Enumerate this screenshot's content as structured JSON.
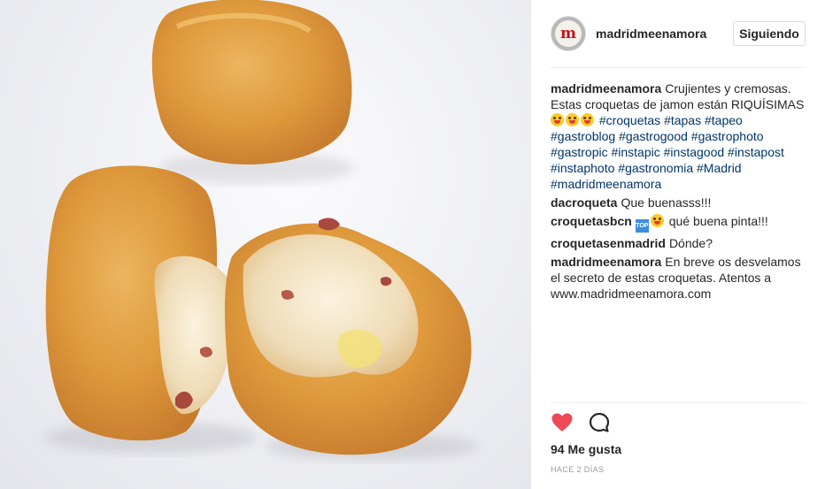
{
  "photo": {
    "alt_icon": "croquetas-photo"
  },
  "header": {
    "username": "madridmeenamora",
    "avatar_letter": "m",
    "follow_label": "Siguiendo"
  },
  "caption": {
    "username": "madridmeenamora",
    "text": "Crujientes y cremosas. Estas croquetas de jamon están RIQUÍSIMAS",
    "hashtags": [
      "#croquetas",
      "#tapas",
      "#tapeo",
      "#gastroblog",
      "#gastrogood",
      "#gastrophoto",
      "#gastropic",
      "#instapic",
      "#instagood",
      "#instapost",
      "#instaphoto",
      "#gastronomia",
      "#Madrid",
      "#madridmeenamora"
    ]
  },
  "comments": [
    {
      "username": "dacroqueta",
      "text": "Que buenasss!!!"
    },
    {
      "username": "croquetasbcn",
      "top_icon": "TOP",
      "text": "qué buena pinta!!!"
    },
    {
      "username": "croquetasenmadrid",
      "text": "Dónde?"
    },
    {
      "username": "madridmeenamora",
      "text": "En breve os desvelamos el secreto de estas croquetas. Atentos a www.madridmeenamora.com"
    }
  ],
  "actions": {
    "like_icon": "heart-icon",
    "comment_icon": "comment-icon"
  },
  "likes": "94 Me gusta",
  "timestamp": "HACE 2 DÍAS",
  "colors": {
    "heart": "#ed4956",
    "hashtag": "#003569",
    "divider": "#efefef"
  }
}
